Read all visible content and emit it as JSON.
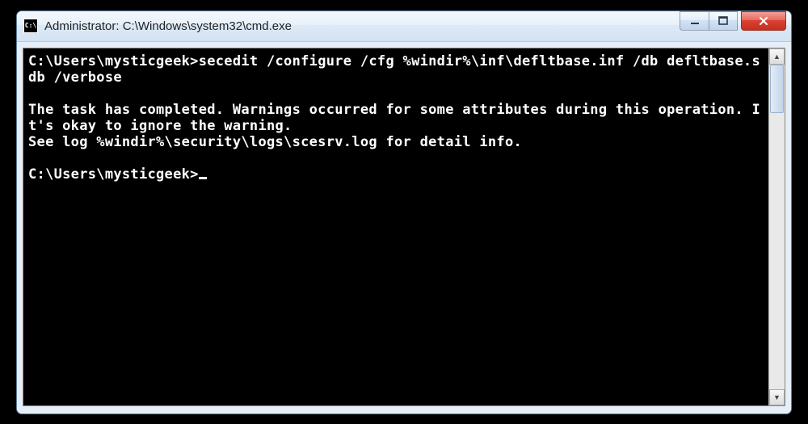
{
  "window": {
    "icon_label": "C:\\",
    "title": "Administrator: C:\\Windows\\system32\\cmd.exe"
  },
  "console": {
    "line1_prompt": "C:\\Users\\mysticgeek>",
    "line1_cmd": "secedit /configure /cfg %windir%\\inf\\defltbase.inf /db defltbase.sdb /verbose",
    "blank": "",
    "msg1": "The task has completed. Warnings occurred for some attributes during this operation. It's okay to ignore the warning.",
    "msg2": "See log %windir%\\security\\logs\\scesrv.log for detail info.",
    "line2_prompt": "C:\\Users\\mysticgeek>"
  },
  "controls": {
    "minimize_glyph": "—",
    "maximize_glyph": "❐",
    "close_glyph": "✕",
    "scroll_up": "▲",
    "scroll_down": "▼"
  }
}
